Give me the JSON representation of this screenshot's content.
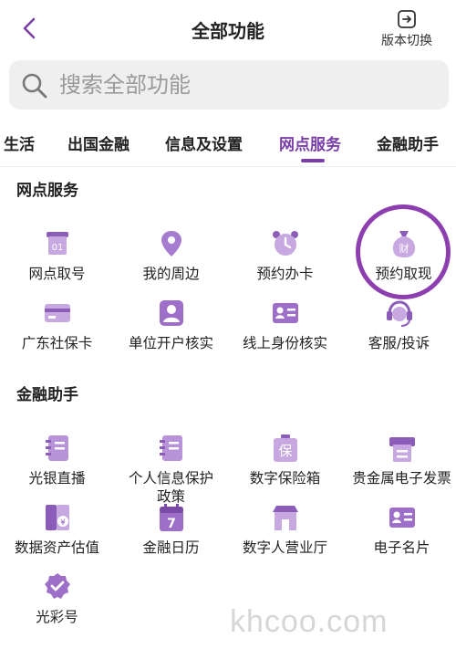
{
  "header": {
    "title": "全部功能",
    "version_label": "版本切换"
  },
  "search": {
    "placeholder": "搜索全部功能"
  },
  "tabs": [
    {
      "label": "生活"
    },
    {
      "label": "出国金融"
    },
    {
      "label": "信息及设置"
    },
    {
      "label": "网点服务",
      "active": true
    },
    {
      "label": "金融助手"
    }
  ],
  "sections": [
    {
      "title": "网点服务",
      "items": [
        {
          "label": "网点取号",
          "icon": "ticket-icon"
        },
        {
          "label": "我的周边",
          "icon": "location-pin-icon"
        },
        {
          "label": "预约办卡",
          "icon": "alarm-clock-icon"
        },
        {
          "label": "预约取现",
          "icon": "money-bag-icon",
          "icon_text": "财",
          "highlighted": true
        },
        {
          "label": "广东社保卡",
          "icon": "card-icon"
        },
        {
          "label": "单位开户核实",
          "icon": "person-badge-icon"
        },
        {
          "label": "线上身份核实",
          "icon": "id-card-icon"
        },
        {
          "label": "客服/投诉",
          "icon": "headset-icon"
        }
      ]
    },
    {
      "title": "金融助手",
      "items": [
        {
          "label": "光银直播",
          "icon": "notebook-icon"
        },
        {
          "label": "个人信息保护政策",
          "icon": "notebook-icon"
        },
        {
          "label": "数字保险箱",
          "icon": "safe-box-icon",
          "icon_text": "保"
        },
        {
          "label": "贵金属电子发票",
          "icon": "printer-icon"
        },
        {
          "label": "数据资产估值",
          "icon": "asset-icon",
          "icon_text": "¥"
        },
        {
          "label": "金融日历",
          "icon": "calendar-icon",
          "icon_text": "7"
        },
        {
          "label": "数字人营业厅",
          "icon": "storefront-icon"
        },
        {
          "label": "电子名片",
          "icon": "business-card-icon"
        },
        {
          "label": "光彩号",
          "icon": "badge-check-icon"
        }
      ]
    }
  ],
  "colors": {
    "accent": "#7a3fa8",
    "icon_light": "#c7a8e0",
    "icon_dark": "#8b5cb8",
    "highlight_ring": "#8d3fb0"
  },
  "watermark": "khcoo.com"
}
